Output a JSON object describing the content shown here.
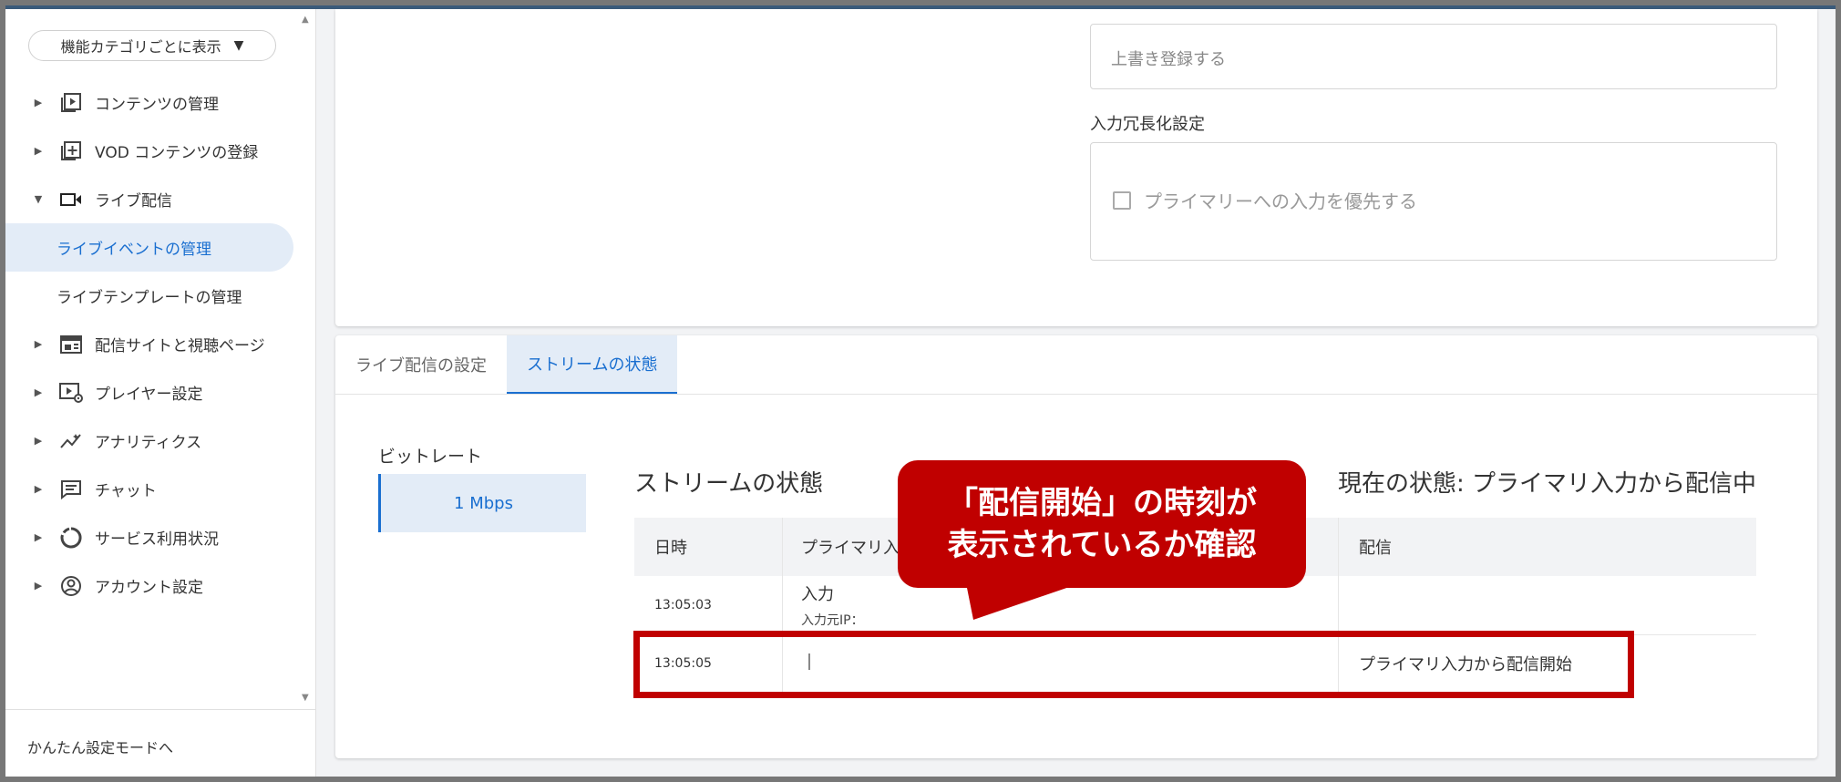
{
  "sidebar": {
    "category_select": "機能カテゴリごとに表示",
    "items": [
      {
        "label": "コンテンツの管理",
        "icon": "play-box-icon",
        "expanded": false
      },
      {
        "label": "VOD コンテンツの登録",
        "icon": "add-box-icon",
        "expanded": false
      },
      {
        "label": "ライブ配信",
        "icon": "video-camera-icon",
        "expanded": true
      },
      {
        "label": "配信サイトと視聴ページ",
        "icon": "web-layout-icon",
        "expanded": false
      },
      {
        "label": "プレイヤー設定",
        "icon": "player-settings-icon",
        "expanded": false
      },
      {
        "label": "アナリティクス",
        "icon": "analytics-icon",
        "expanded": false
      },
      {
        "label": "チャット",
        "icon": "chat-icon",
        "expanded": false
      },
      {
        "label": "サービス利用状況",
        "icon": "usage-ring-icon",
        "expanded": false
      },
      {
        "label": "アカウント設定",
        "icon": "account-circle-icon",
        "expanded": false
      }
    ],
    "subitems": [
      {
        "label": "ライブイベントの管理",
        "active": true
      },
      {
        "label": "ライブテンプレートの管理",
        "active": false
      }
    ],
    "footer": "かんたん設定モードへ"
  },
  "settings": {
    "overwrite_field": "上書き登録する",
    "redundancy_label": "入力冗長化設定",
    "prefer_primary": "プライマリーへの入力を優先する"
  },
  "tabs": [
    {
      "label": "ライブ配信の設定",
      "active": false
    },
    {
      "label": "ストリームの状態",
      "active": true
    }
  ],
  "stream": {
    "bitrate_label": "ビットレート",
    "bitrate_value": "1 Mbps",
    "title": "ストリームの状態",
    "current_status": "現在の状態: プライマリ入力から配信中",
    "columns": [
      "日時",
      "プライマリ入",
      "配信"
    ],
    "rows": [
      {
        "time": "13:05:03",
        "input": "入力",
        "input_sub": "入力元IP：",
        "delivery": ""
      },
      {
        "time": "13:05:05",
        "input": "",
        "input_sub": "",
        "delivery": "プライマリ入力から配信開始"
      }
    ]
  },
  "annotation": {
    "line1": "「配信開始」の時刻が",
    "line2": "表示されているか確認"
  },
  "colors": {
    "accent": "#1a6fd0",
    "active_bg": "#e3ecf7",
    "annotation_red": "#c00000"
  }
}
